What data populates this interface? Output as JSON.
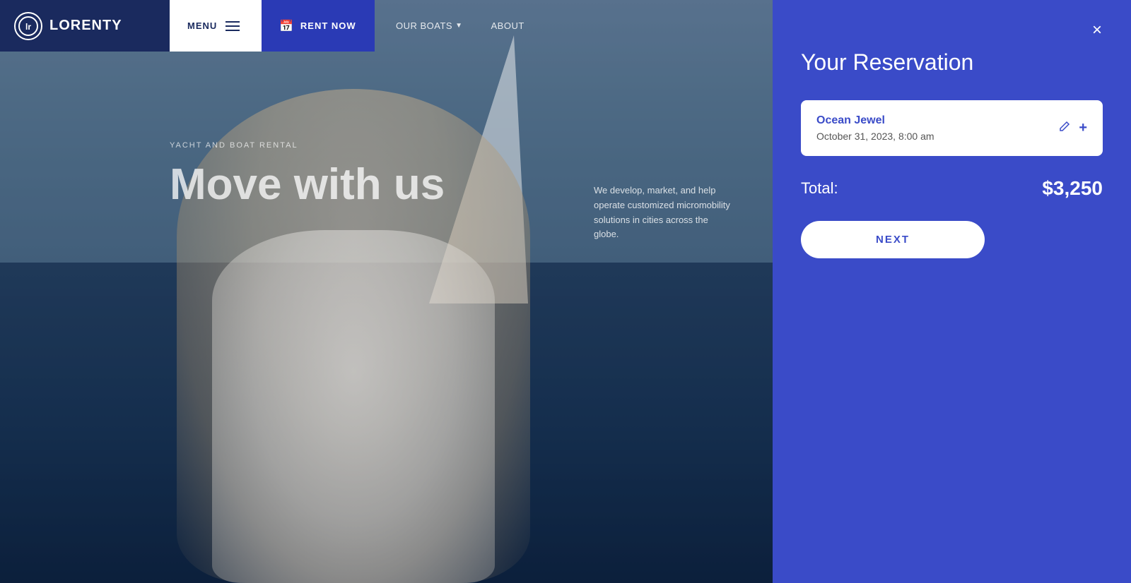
{
  "navbar": {
    "logo_letters": "lr",
    "logo_name": "LORENTY",
    "menu_label": "MENU",
    "rent_now_label": "RENT NOW",
    "nav_items": [
      {
        "label": "OUR BOATS",
        "has_dropdown": true
      },
      {
        "label": "ABOUT",
        "has_dropdown": false
      }
    ]
  },
  "hero": {
    "subtitle": "YACHT AND BOAT RENTAL",
    "title": "Move with us",
    "description": "We develop, market, and help operate customized micromobility solutions in cities across the globe."
  },
  "reservation_panel": {
    "title": "Your Reservation",
    "close_label": "×",
    "boat_name": "Ocean Jewel",
    "date": "October 31, 2023, 8:00 am",
    "total_label": "Total:",
    "total_amount": "$3,250",
    "next_button_label": "NEXT"
  },
  "colors": {
    "brand_blue": "#1a2a5e",
    "accent_blue": "#3a4bc8",
    "nav_bg": "#ffffff",
    "rent_bg": "#2a3ab5"
  }
}
